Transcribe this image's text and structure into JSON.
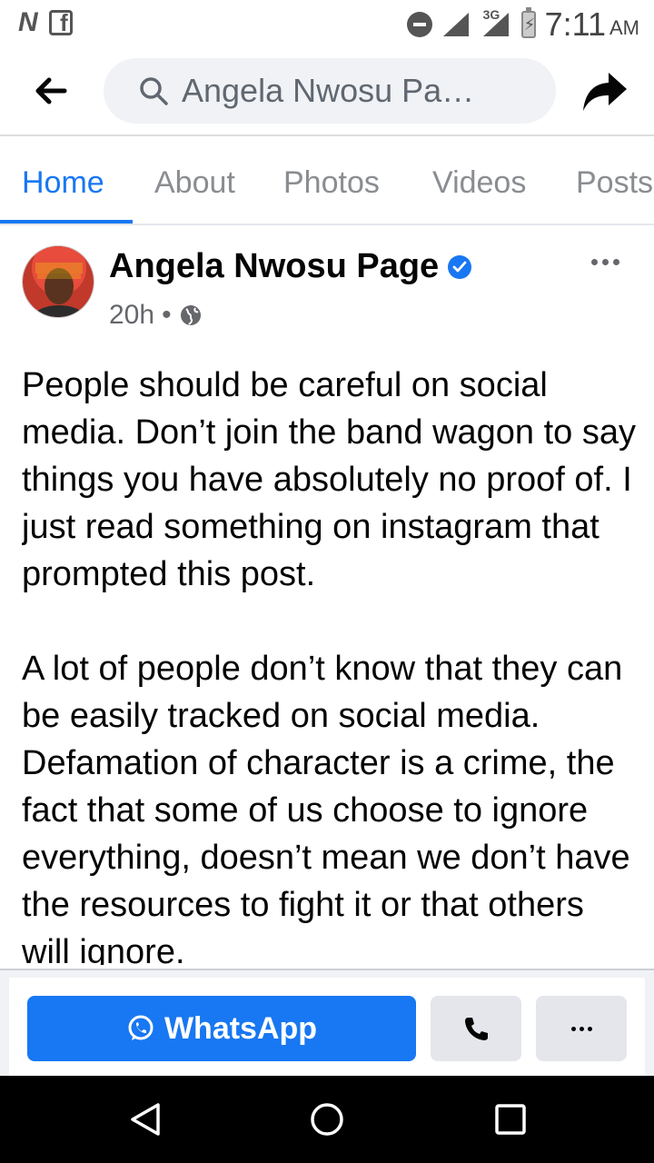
{
  "status_bar": {
    "time": "7:11",
    "ampm": "AM",
    "network": "3G",
    "icons": [
      "netflix-icon",
      "facebook-icon",
      "do-not-disturb-icon",
      "signal-icon",
      "battery-charging-icon"
    ]
  },
  "top_nav": {
    "search_text": "Angela Nwosu Pa…",
    "icons": [
      "back-arrow-icon",
      "search-icon",
      "share-icon"
    ]
  },
  "tabs": [
    {
      "label": "Home",
      "active": true
    },
    {
      "label": "About",
      "active": false
    },
    {
      "label": "Photos",
      "active": false
    },
    {
      "label": "Videos",
      "active": false
    },
    {
      "label": "Posts",
      "active": false
    }
  ],
  "post": {
    "page_name": "Angela Nwosu Page",
    "verified": true,
    "time_ago": "20h",
    "separator": "•",
    "privacy": "public",
    "paragraphs": [
      "People should be careful on social media. Don’t join the band wagon to say things you have absolutely no proof of. I just read something on instagram that prompted this post.",
      "A lot of people don’t know that they can be easily tracked on social media. Defamation of character is a crime, the fact that some of us choose to ignore everything, doesn’t mean we don’t have the resources to fight it or that others will ignore."
    ]
  },
  "action_bar": {
    "whatsapp_label": "WhatsApp"
  },
  "colors": {
    "brand_blue": "#1877f2",
    "button_gray": "#e4e6eb",
    "text_secondary": "#65676b"
  }
}
